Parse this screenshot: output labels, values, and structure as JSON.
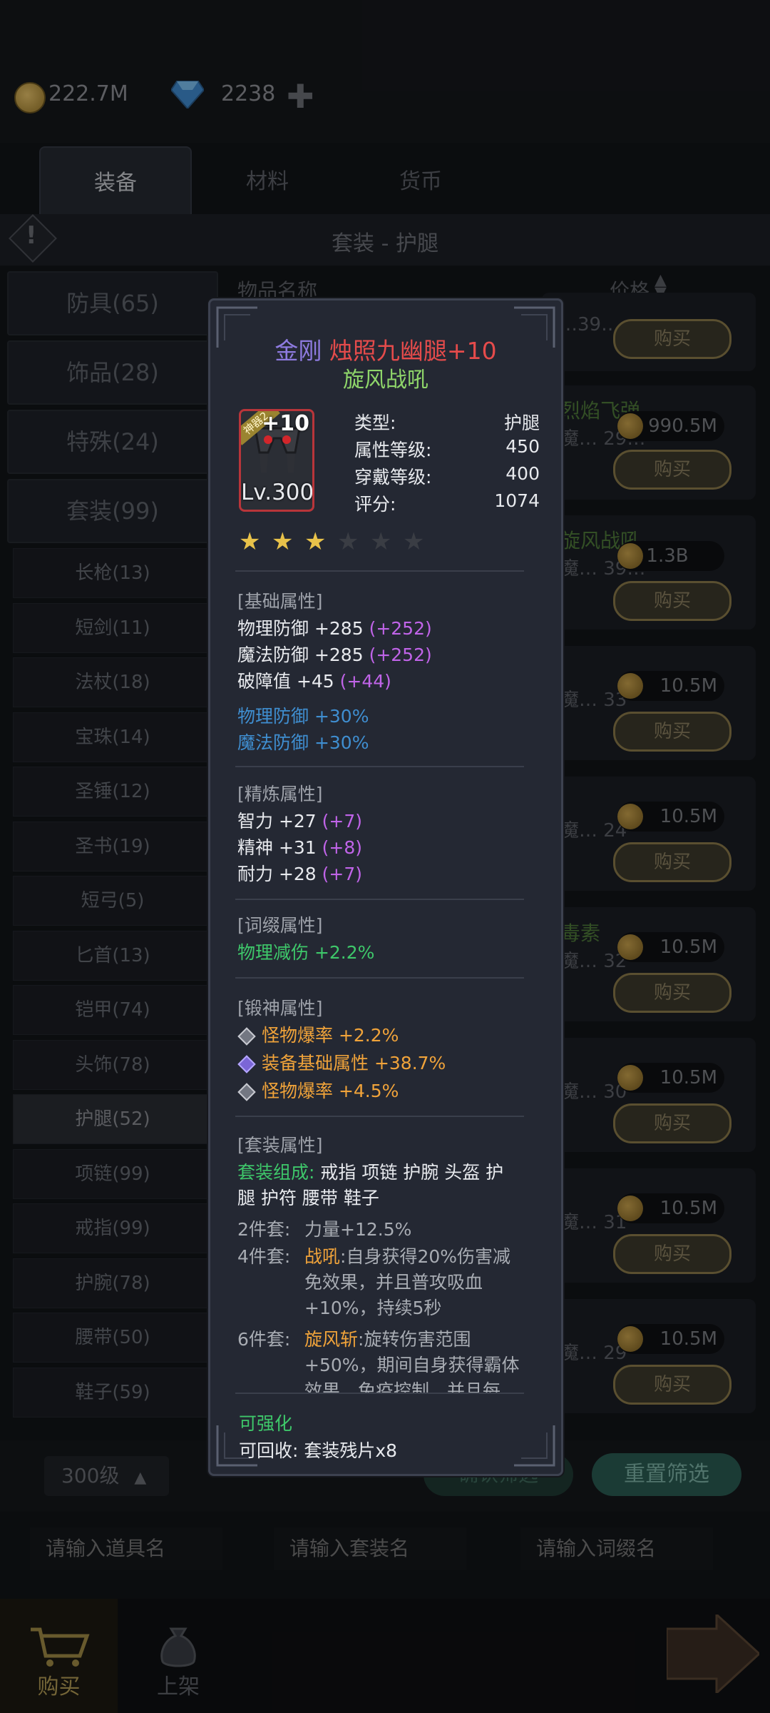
{
  "currency": {
    "gold": "222.7M",
    "gems": "2238"
  },
  "tabs": [
    {
      "label": "装备"
    },
    {
      "label": "材料"
    },
    {
      "label": "货币"
    }
  ],
  "header": {
    "title": "套装 - 护腿"
  },
  "columns": {
    "name": "物品名称",
    "price": "价格"
  },
  "categories_main": [
    {
      "label": "防具(65)"
    },
    {
      "label": "饰品(28)"
    },
    {
      "label": "特殊(24)"
    },
    {
      "label": "套装(99)"
    }
  ],
  "categories_sub": [
    {
      "label": "长枪(13)"
    },
    {
      "label": "短剑(11)"
    },
    {
      "label": "法杖(18)"
    },
    {
      "label": "宝珠(14)"
    },
    {
      "label": "圣锤(12)"
    },
    {
      "label": "圣书(19)"
    },
    {
      "label": "短弓(5)"
    },
    {
      "label": "匕首(13)"
    },
    {
      "label": "铠甲(74)"
    },
    {
      "label": "头饰(78)"
    },
    {
      "label": "护腿(52)"
    },
    {
      "label": "项链(99)"
    },
    {
      "label": "戒指(99)"
    },
    {
      "label": "护腕(78)"
    },
    {
      "label": "腰带(50)"
    },
    {
      "label": "鞋子(59)"
    }
  ],
  "rows": [
    {
      "name": "",
      "sub": "…39…",
      "price": "",
      "buy": "购买"
    },
    {
      "name": "烈焰飞弹",
      "sub": "魔… 29…",
      "price": "990.5M",
      "buy": "购买"
    },
    {
      "name": "旋风战吼",
      "sub": "魔… 39…",
      "price": "1.3B",
      "buy": "购买"
    },
    {
      "name": "",
      "sub": "魔… 33",
      "price": "10.5M",
      "buy": "购买"
    },
    {
      "name": "",
      "sub": "魔… 24",
      "price": "10.5M",
      "buy": "购买"
    },
    {
      "name": "毒素",
      "sub": "魔… 32",
      "price": "10.5M",
      "buy": "购买"
    },
    {
      "name": "",
      "sub": "魔… 30",
      "price": "10.5M",
      "buy": "购买"
    },
    {
      "name": "",
      "sub": "魔… 31",
      "price": "10.5M",
      "buy": "购买"
    },
    {
      "name": "",
      "sub": "魔… 29",
      "price": "10.5M",
      "buy": "购买"
    }
  ],
  "filters": {
    "level": "300级",
    "reset": "重置筛选",
    "confirm": "确认筛选"
  },
  "inputs": {
    "item_placeholder": "请输入道具名",
    "set_placeholder": "请输入套装名",
    "affix_placeholder": "请输入词缀名"
  },
  "nav": {
    "buy": "购买",
    "list": "上架"
  },
  "popup": {
    "title_prefix": "金刚",
    "title_main": "烛照九幽腿+10",
    "subtitle": "旋风战吼",
    "badge": "+10",
    "level": "Lv.300",
    "tag": "神器2",
    "info": [
      {
        "k": "类型:",
        "v": "护腿"
      },
      {
        "k": "属性等级:",
        "v": "450"
      },
      {
        "k": "穿戴等级:",
        "v": "400"
      },
      {
        "k": "评分:",
        "v": "1074"
      }
    ],
    "stars_filled": 3,
    "stars_total": 6,
    "base_header": "[基础属性]",
    "base": [
      {
        "text": "物理防御 +285",
        "bonus": "(+252)"
      },
      {
        "text": "魔法防御 +285",
        "bonus": "(+252)"
      },
      {
        "text": "破障值 +45",
        "bonus": "(+44)"
      }
    ],
    "base_extra": [
      "物理防御 +30%",
      "魔法防御 +30%"
    ],
    "refine_header": "[精炼属性]",
    "refine": [
      {
        "text": "智力 +27",
        "bonus": "(+7)"
      },
      {
        "text": "精神 +31",
        "bonus": "(+8)"
      },
      {
        "text": "耐力 +28",
        "bonus": "(+7)"
      }
    ],
    "affix_header": "[词缀属性]",
    "affix": "物理减伤 +2.2%",
    "forge_header": "[锻神属性]",
    "forge": [
      "怪物爆率 +2.2%",
      "装备基础属性 +38.7%",
      "怪物爆率 +4.5%"
    ],
    "set_header": "[套装属性]",
    "set_comp_label": "套装组成:",
    "set_comp_line1": "戒指 项链 护腕 头盔 护",
    "set_comp_line2": "腿 护符 腰带 鞋子",
    "set2_label": "2件套:",
    "set2_text": "力量+12.5%",
    "set4_label": "4件套:",
    "set4_skill": "战吼",
    "set4_line1": ":自身获得20%伤害减",
    "set4_line2": "免效果，并且普攻吸血",
    "set4_line3": "+10%，持续5秒",
    "set6_label": "6件套:",
    "set6_skill": "旋风斩",
    "set6_line1": ":旋转伤害范围",
    "set6_line2": "+50%，期间自身获得霸体",
    "set6_line3": "效果，免疫控制，并且每",
    "enhance": "可强化",
    "recycle": "可回收: 套装残片x8"
  },
  "colors": {
    "title_prefix": "#8e7be0",
    "title_main": "#e54b4b",
    "subtitle": "#8fd66a",
    "purple": "#c064e8",
    "blue": "#3f8ed0",
    "green": "#3ec76a",
    "orange": "#f0a33a"
  }
}
